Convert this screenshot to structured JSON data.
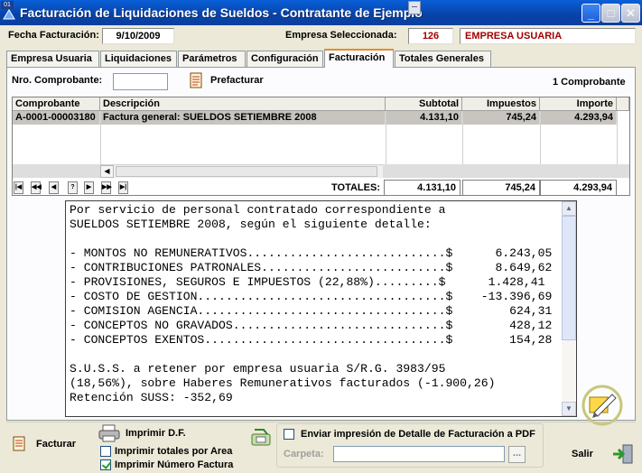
{
  "window": {
    "badge": "01",
    "title": "Facturación de Liquidaciones de Sueldos - Contratante de Ejemplo",
    "buttons": {
      "minimize": "_",
      "maximize": "□",
      "close": "✕"
    }
  },
  "header": {
    "fecha_label": "Fecha Facturación:",
    "fecha_value": "9/10/2009",
    "empresa_label": "Empresa Seleccionada:",
    "empresa_code": "126",
    "empresa_name": "EMPRESA USUARIA"
  },
  "tabs": [
    {
      "label": "Empresa Usuaria"
    },
    {
      "label": "Liquidaciones"
    },
    {
      "label": "Parámetros"
    },
    {
      "label": "Configuración"
    },
    {
      "label": "Facturación",
      "active": true
    },
    {
      "label": "Totales Generales"
    }
  ],
  "toolbar": {
    "nro_label": "Nro. Comprobante:",
    "nro_value": "",
    "prefacturar": "Prefacturar",
    "count": "1 Comprobante"
  },
  "grid": {
    "columns": [
      "Comprobante",
      "Descripción",
      "Subtotal",
      "Impuestos",
      "Importe"
    ],
    "rows": [
      [
        "A-0001-00003180",
        "Factura general: SUELDOS SETIEMBRE 2008",
        "4.131,10",
        "745,24",
        "4.293,94"
      ]
    ],
    "nav": [
      "|◀",
      "◀◀",
      "◀",
      "?",
      "▶",
      "▶▶",
      "▶|"
    ],
    "totals_label": "TOTALES:",
    "totals": [
      "4.131,10",
      "745,24",
      "4.293,94"
    ]
  },
  "detail": {
    "lines": [
      "Por servicio de personal contratado correspondiente a",
      "SUELDOS SETIEMBRE 2008, según el siguiente detalle:",
      "",
      "- MONTOS NO REMUNERATIVOS............................$      6.243,05",
      "- CONTRIBUCIONES PATRONALES..........................$      8.649,62",
      "- PROVISIONES, SEGUROS E IMPUESTOS (22,88%).........$      1.428,41",
      "- COSTO DE GESTION...................................$    -13.396,69",
      "- COMISION AGENCIA...................................$        624,31",
      "- CONCEPTOS NO GRAVADOS..............................$        428,12",
      "- CONCEPTOS EXENTOS..................................$        154,28",
      "",
      "S.U.S.S. a retener por empresa usuaria S/R.G. 3983/95",
      "(18,56%), sobre Haberes Remunerativos facturados (-1.900,26)",
      "Retención SUSS: -352,69"
    ]
  },
  "bottom": {
    "facturar": "Facturar",
    "imprimir_df": "Imprimir D.F.",
    "imprimir_totales": "Imprimir totales por Area",
    "imprimir_numero": "Imprimir Número Factura",
    "enviar_pdf": "Enviar impresión de Detalle de Facturación a PDF",
    "carpeta_label": "Carpeta:",
    "carpeta_value": "",
    "browse": "...",
    "salir": "Salir"
  },
  "colors": {
    "titlebar": "#0842a8",
    "empresa_red": "#a40000",
    "tab_active_accent": "#e68b2c",
    "selected_row": "#c8c4c0"
  }
}
